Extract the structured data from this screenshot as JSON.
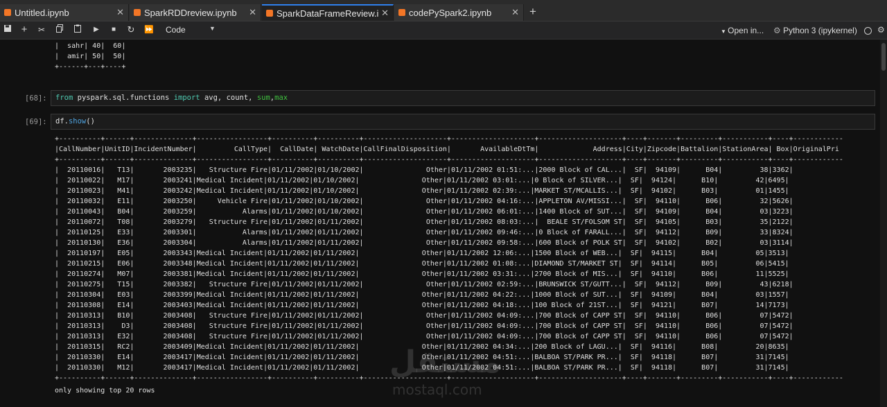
{
  "tabs": [
    {
      "label": "Untitled.ipynb",
      "close": "✕"
    },
    {
      "label": "SparkRDDreview.ipynb",
      "close": "✕"
    },
    {
      "label": "SparkDataFrameReview.ipynb",
      "close": "✕"
    },
    {
      "label": "codePySpark2.ipynb",
      "close": "✕"
    }
  ],
  "add_tab": "+",
  "toolbar": {
    "cell_type": "Code",
    "open_in": "Open in...",
    "kernel": "Python 3 (ipykernel)"
  },
  "prev_output": "|  sahr| 40|  60|\n|  amir| 50|  50|\n+------+---+----+",
  "cells": [
    {
      "prompt": "[68]:",
      "code_from": "from",
      "code_mod": " pyspark.sql.functions ",
      "code_import": "import",
      "code_names": " avg, count, ",
      "code_sum": "sum",
      "code_comma": ",",
      "code_max": "max"
    },
    {
      "prompt": "[69]:",
      "code_obj": "df.",
      "code_method": "show",
      "code_parens": "()"
    }
  ],
  "df_table": "+----------+------+--------------+-----------------+----------+----------+--------------------+--------------------+--------------------+----+-------+---------+-----------+----+------------\n|CallNumber|UnitID|IncidentNumber|         CallType|  CallDate| WatchDate|CallFinalDisposition|       AvailableDtTm|             Address|City|Zipcode|Battalion|StationArea| Box|OriginalPri\n+----------+------+--------------+-----------------+----------+----------+--------------------+--------------------+--------------------+----+-------+---------+-----------+----+------------\n|  20110016|   T13|       2003235|   Structure Fire|01/11/2002|01/10/2002|               Other|01/11/2002 01:51:...|2000 Block of CAL...|  SF|  94109|      B04|         38|3362|\n|  20110022|   M17|       2003241|Medical Incident|01/11/2002|01/10/2002|               Other|01/11/2002 03:01:...|0 Block of SILVER...|  SF|  94124|      B10|         42|6495|\n|  20110023|   M41|       2003242|Medical Incident|01/11/2002|01/10/2002|               Other|01/11/2002 02:39:...|MARKET ST/MCALLIS...|  SF|  94102|      B03|         01|1455|\n|  20110032|   E11|       2003250|     Vehicle Fire|01/11/2002|01/10/2002|               Other|01/11/2002 04:16:...|APPLETON AV/MISSI...|  SF|  94110|      B06|         32|5626|\n|  20110043|   B04|       2003259|           Alarms|01/11/2002|01/10/2002|               Other|01/11/2002 06:01:...|1400 Block of SUT...|  SF|  94109|      B04|         03|3223|\n|  20110072|   T08|       2003279|   Structure Fire|01/11/2002|01/11/2002|               Other|01/11/2002 08:03:...|  BEALE ST/FOLSOM ST|  SF|  94105|      B03|         35|2122|\n|  20110125|   E33|       2003301|           Alarms|01/11/2002|01/11/2002|               Other|01/11/2002 09:46:...|0 Block of FARALL...|  SF|  94112|      B09|         33|8324|\n|  20110130|   E36|       2003304|           Alarms|01/11/2002|01/11/2002|               Other|01/11/2002 09:58:...|600 Block of POLK ST|  SF|  94102|      B02|         03|3114|\n|  20110197|   E05|       2003343|Medical Incident|01/11/2002|01/11/2002|               Other|01/11/2002 12:06:...|1500 Block of WEB...|  SF|  94115|      B04|         05|3513|\n|  20110215|   E06|       2003348|Medical Incident|01/11/2002|01/11/2002|               Other|01/11/2002 01:08:...|DIAMOND ST/MARKET ST|  SF|  94114|      B05|         06|5415|\n|  20110274|   M07|       2003381|Medical Incident|01/11/2002|01/11/2002|               Other|01/11/2002 03:31:...|2700 Block of MIS...|  SF|  94110|      B06|         11|5525|\n|  20110275|   T15|       2003382|   Structure Fire|01/11/2002|01/11/2002|               Other|01/11/2002 02:59:...|BRUNSWICK ST/GUTT...|  SF|  94112|      B09|         43|6218|\n|  20110304|   E03|       2003399|Medical Incident|01/11/2002|01/11/2002|               Other|01/11/2002 04:22:...|1000 Block of SUT...|  SF|  94109|      B04|         03|1557|\n|  20110308|   E14|       2003403|Medical Incident|01/11/2002|01/11/2002|               Other|01/11/2002 04:18:...|100 Block of 21ST...|  SF|  94121|      B07|         14|7173|\n|  20110313|   B10|       2003408|   Structure Fire|01/11/2002|01/11/2002|               Other|01/11/2002 04:09:...|700 Block of CAPP ST|  SF|  94110|      B06|         07|5472|\n|  20110313|    D3|       2003408|   Structure Fire|01/11/2002|01/11/2002|               Other|01/11/2002 04:09:...|700 Block of CAPP ST|  SF|  94110|      B06|         07|5472|\n|  20110313|   E32|       2003408|   Structure Fire|01/11/2002|01/11/2002|               Other|01/11/2002 04:09:...|700 Block of CAPP ST|  SF|  94110|      B06|         07|5472|\n|  20110315|   RC2|       2003409|Medical Incident|01/11/2002|01/11/2002|               Other|01/11/2002 04:34:...|200 Block of LAGU...|  SF|  94116|      B08|         20|8635|\n|  20110330|   E14|       2003417|Medical Incident|01/11/2002|01/11/2002|               Other|01/11/2002 04:51:...|BALBOA ST/PARK PR...|  SF|  94118|      B07|         31|7145|\n|  20110330|   M12|       2003417|Medical Incident|01/11/2002|01/11/2002|               Other|01/11/2002 04:51:...|BALBOA ST/PARK PR...|  SF|  94118|      B07|         31|7145|\n+----------+------+--------------+-----------------+----------+----------+--------------------+--------------------+--------------------+----+-------+---------+-----------+----+------------",
  "footer_note": "only showing top 20 rows",
  "watermark": {
    "arabic": "مستقل",
    "latin": "mostaql.com"
  },
  "colors": {
    "accent": "#2f80ed",
    "jupyter_orange": "#f37626",
    "keyword": "#4ec9b0",
    "builtin": "#3fbf3f",
    "function": "#4fa3e0"
  }
}
